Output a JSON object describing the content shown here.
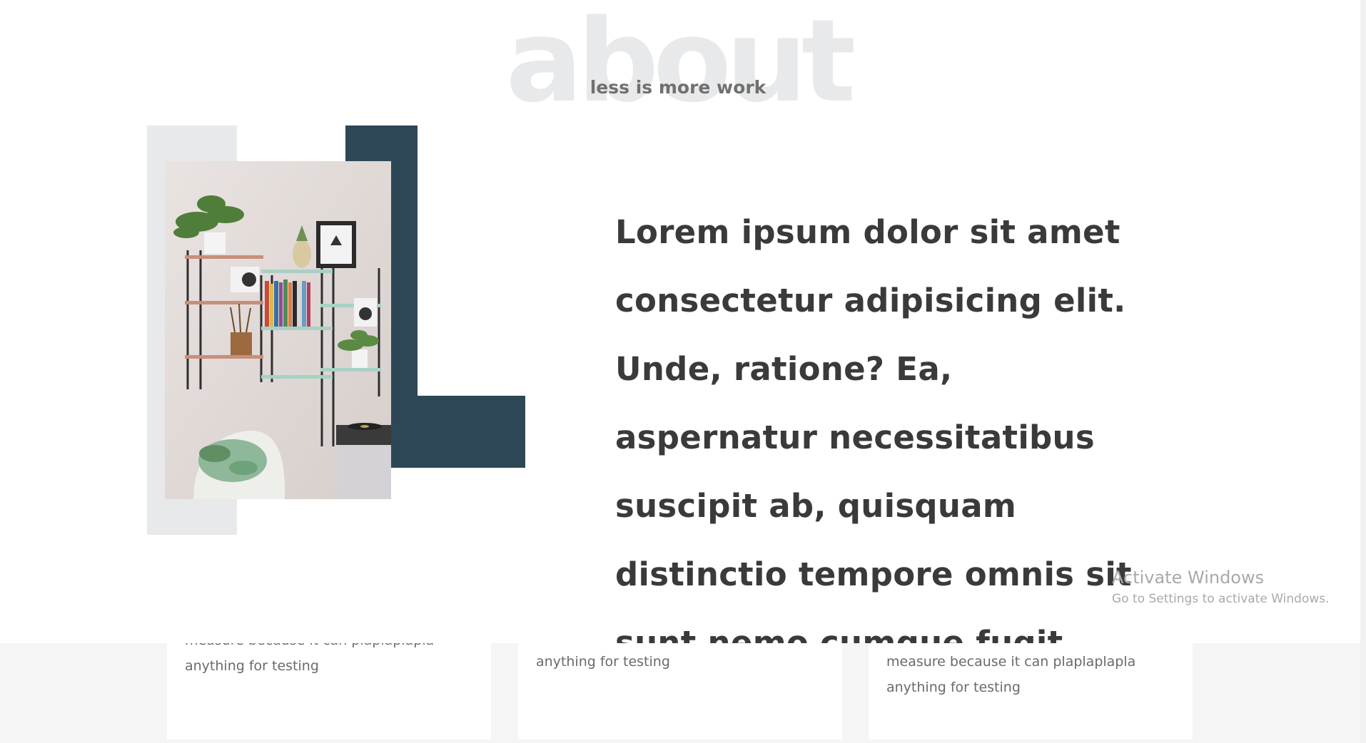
{
  "about": {
    "title": "about",
    "subtitle": "less is more work",
    "paragraph": "Lorem ipsum dolor sit amet consectetur adipisicing elit. Unde, ratione? Ea, aspernatur necessitatibus suscipit ab, quisquam distinctio tempore omnis sit sunt nemo cumque fugit fugiat magnam explicabo"
  },
  "colors": {
    "accent_dark": "#2d4756",
    "accent_light": "#e8e9eb",
    "heading_text": "#3a3a3a"
  },
  "image": {
    "subject": "wall shelves with plants, books, speaker and chair",
    "icon": "photo-interior-shelves"
  },
  "services": {
    "cards": [
      {
        "text": "measure because it can plaplaplapla anything for testing"
      },
      {
        "text": "measure because it can plaplaplapla anything for testing"
      },
      {
        "text": "my creative ability is very difficult to measure because it can plaplaplapla anything for testing"
      }
    ]
  },
  "watermark": {
    "title": "Activate Windows",
    "subtitle": "Go to Settings to activate Windows."
  }
}
